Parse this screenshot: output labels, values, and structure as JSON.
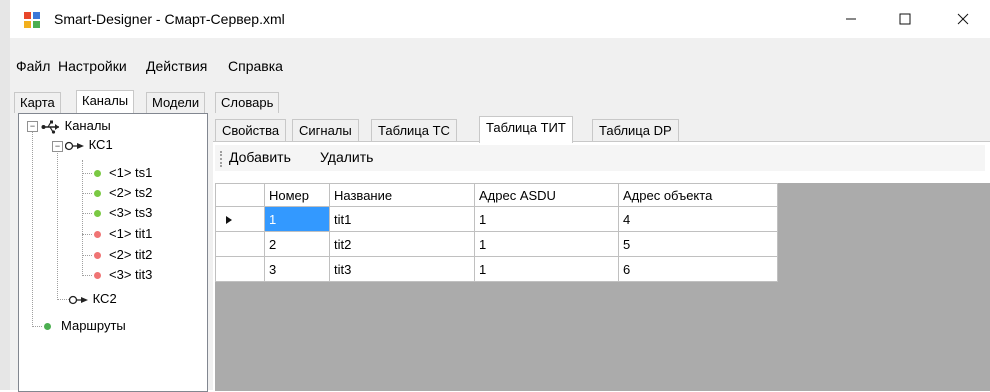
{
  "window": {
    "title": "Smart-Designer - Смарт-Сервер.xml"
  },
  "menu": [
    "Файл",
    "Настройки",
    "Действия",
    "Справка"
  ],
  "main_tabs": [
    "Карта",
    "Каналы",
    "Модели",
    "Словарь"
  ],
  "tree": {
    "root": "Каналы",
    "channels": [
      {
        "label": "КС1",
        "items": [
          {
            "label": "<1> ts1",
            "status": "green"
          },
          {
            "label": "<2> ts2",
            "status": "green"
          },
          {
            "label": "<3> ts3",
            "status": "green"
          },
          {
            "label": "<1> tit1",
            "status": "red"
          },
          {
            "label": "<2> tit2",
            "status": "red"
          },
          {
            "label": "<3> tit3",
            "status": "red"
          }
        ]
      },
      {
        "label": "КС2"
      }
    ],
    "routes": "Маршруты"
  },
  "sub_tabs": [
    "Свойства",
    "Сигналы",
    "Таблица ТС",
    "Таблица ТИТ",
    "Таблица DP"
  ],
  "toolbar": {
    "add": "Добавить",
    "delete": "Удалить"
  },
  "grid": {
    "columns": [
      "Номер",
      "Название",
      "Адрес ASDU",
      "Адрес объекта"
    ],
    "rows": [
      [
        "1",
        "tit1",
        "1",
        "4"
      ],
      [
        "2",
        "tit2",
        "1",
        "5"
      ],
      [
        "3",
        "tit3",
        "1",
        "6"
      ]
    ]
  },
  "colors": {
    "status_green": "#7ac943",
    "status_red": "#f07474",
    "selection": "#3399ff",
    "grid_bg": "#ababab"
  }
}
